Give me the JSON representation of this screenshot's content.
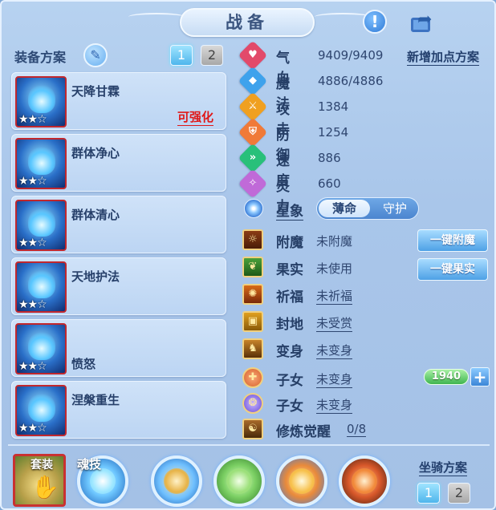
{
  "title": "战备",
  "icons": {
    "help": "help-icon",
    "share": "share-icon",
    "edit": "pencil-icon",
    "add": "plus-icon"
  },
  "equip_plan": {
    "label": "装备方案",
    "tabs": [
      "1",
      "2"
    ],
    "selected": "1"
  },
  "skills": [
    {
      "name": "天降甘霖",
      "stars": "★★☆",
      "badge": "可强化"
    },
    {
      "name": "群体净心",
      "stars": "★★☆"
    },
    {
      "name": "群体清心",
      "stars": "★★☆"
    },
    {
      "name": "天地护法",
      "stars": "★★☆"
    },
    {
      "name": "愤怒",
      "stars": "★★☆"
    },
    {
      "name": "涅槃重生",
      "stars": "★★☆"
    }
  ],
  "new_point_plan": "新增加点方案",
  "attributes": [
    {
      "label": "气血",
      "value": "9409/9409",
      "color": "#e24a6a",
      "glyph": "♥"
    },
    {
      "label": "魔法",
      "value": "4886/4886",
      "color": "#3ea2ec",
      "glyph": "◆"
    },
    {
      "label": "攻击",
      "value": "1384",
      "color": "#f0a020",
      "glyph": "⚔"
    },
    {
      "label": "防御",
      "value": "1254",
      "color": "#f07a38",
      "glyph": "⛨"
    },
    {
      "label": "速度",
      "value": "886",
      "color": "#28c07a",
      "glyph": "»"
    },
    {
      "label": "灵力",
      "value": "660",
      "color": "#c06ad8",
      "glyph": "✧"
    }
  ],
  "star_sign": {
    "label": "星象",
    "options": [
      "薄命",
      "守护"
    ],
    "selected": "薄命"
  },
  "features": [
    {
      "label": "附魔",
      "value": "未附魔",
      "underline": false,
      "icon": "enchant-icon",
      "glyph": "☼"
    },
    {
      "label": "果实",
      "value": "未使用",
      "underline": false,
      "icon": "fruit-icon",
      "glyph": "❦"
    },
    {
      "label": "祈福",
      "value": "未祈福",
      "underline": true,
      "icon": "blessing-icon",
      "glyph": "✺"
    },
    {
      "label": "封地",
      "value": "未受赏",
      "underline": true,
      "icon": "fief-icon",
      "glyph": "▣"
    },
    {
      "label": "变身",
      "value": "未变身",
      "underline": true,
      "icon": "transform-icon",
      "glyph": "♞"
    },
    {
      "label": "子女",
      "value": "未变身",
      "underline": true,
      "icon": "child-icon",
      "glyph": "✚"
    },
    {
      "label": "子女",
      "value": "未变身",
      "underline": true,
      "icon": "child-icon-2",
      "glyph": "❂"
    },
    {
      "label": "修炼觉醒",
      "value": "0/8",
      "underline": true,
      "icon": "cultivation-icon",
      "glyph": "☯"
    }
  ],
  "buttons": {
    "enchant_all": "一键附魔",
    "fruit_all": "一键果实"
  },
  "child_points": "1940",
  "bottom": {
    "set_label": "套装",
    "soul_label": "魂技",
    "mount_plan_label": "坐骑方案",
    "mount_tabs": [
      "1",
      "2"
    ],
    "mount_selected": "1"
  },
  "colors": {
    "accent": "#4fb6ec",
    "warning": "#e01818",
    "panel": "#a9c6ea"
  }
}
